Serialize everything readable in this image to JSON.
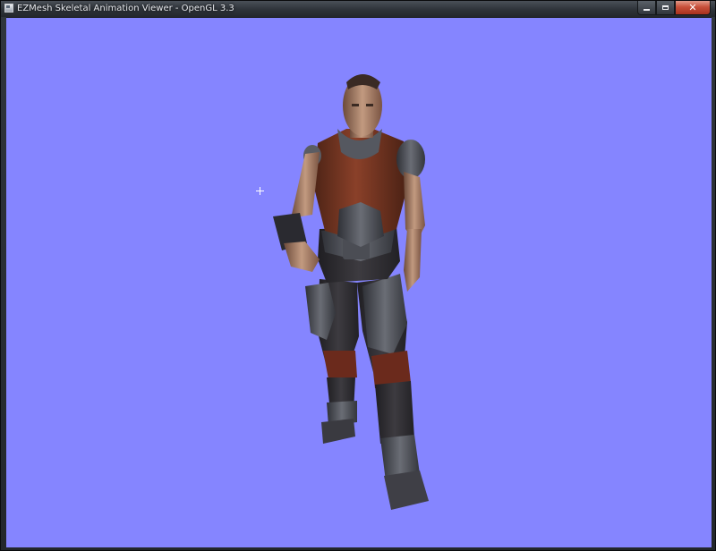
{
  "window": {
    "title": "EZMesh Skeletal Animation Viewer - OpenGL 3.3",
    "icon": "app-window-icon",
    "buttons": {
      "minimize": "minimize-icon",
      "maximize": "maximize-icon",
      "close": "close-icon",
      "close_glyph": "✕"
    }
  },
  "viewport": {
    "background_color": "#8585ff",
    "crosshair_icon": "crosshair-icon",
    "model": "armored-soldier-character"
  },
  "colors": {
    "skin": "#b88e74",
    "vest": "#7a3a24",
    "armor": "#4a4d55",
    "suit": "#2f2e33",
    "pad": "#6b2a1c"
  }
}
